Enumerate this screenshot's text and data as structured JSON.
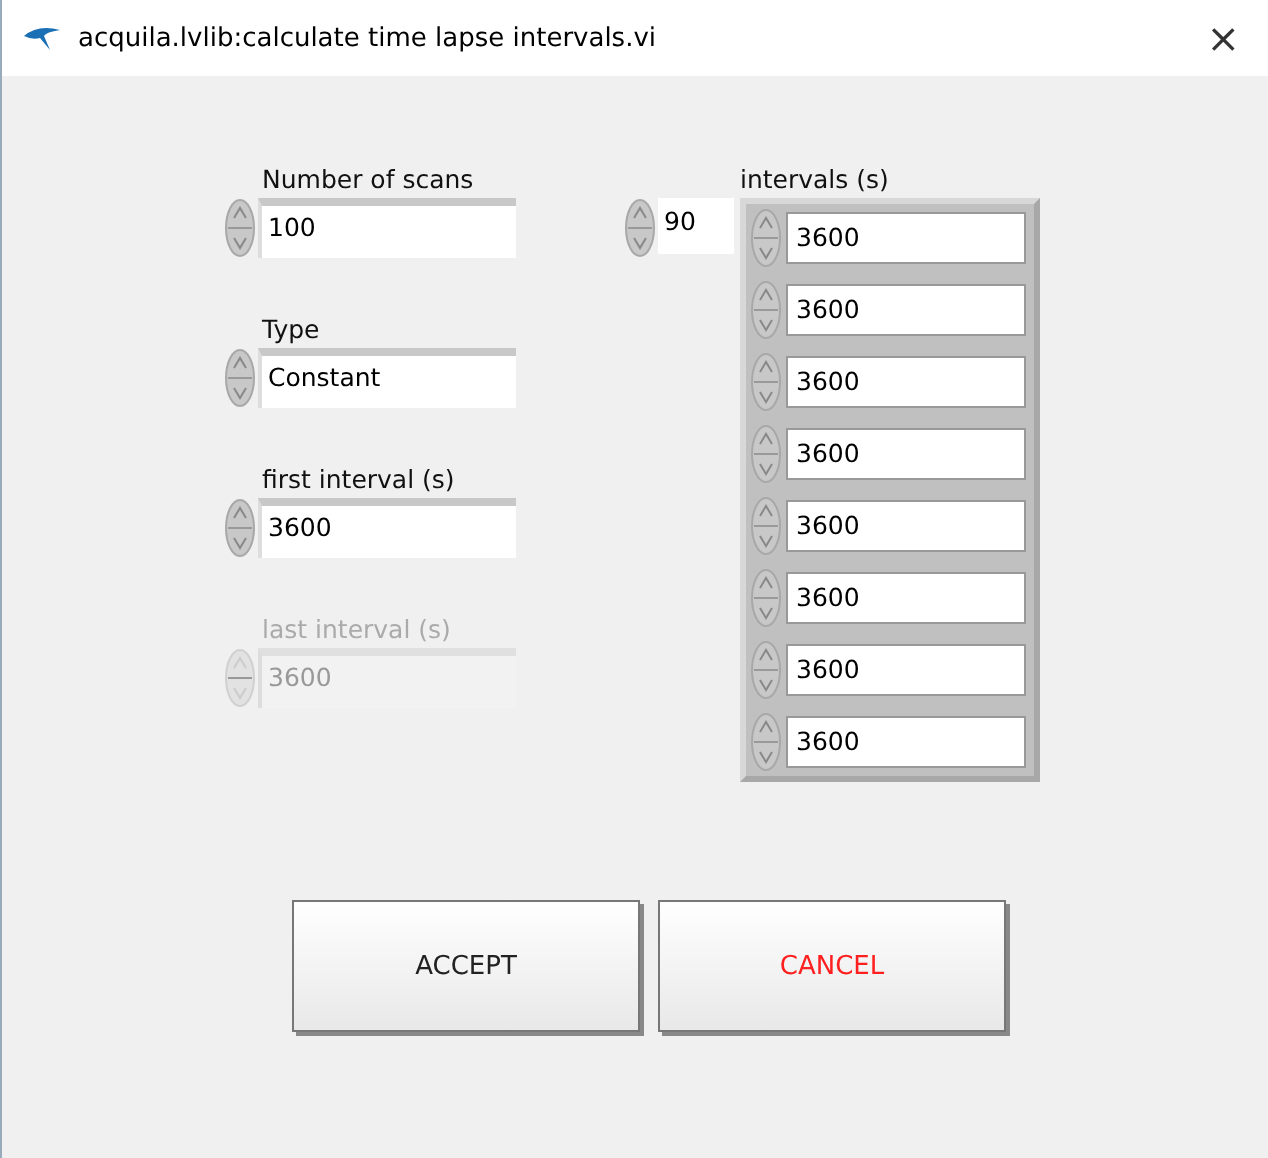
{
  "window": {
    "title": "acquila.lvlib:calculate time lapse intervals.vi",
    "close": "×"
  },
  "controls": [
    {
      "label": "Number of scans",
      "value": "100",
      "disabled": false
    },
    {
      "label": "Type",
      "value": "Constant",
      "disabled": false
    },
    {
      "label": "first interval (s)",
      "value": "3600",
      "disabled": false
    },
    {
      "label": "last interval (s)",
      "value": "3600",
      "disabled": true
    }
  ],
  "intervals": {
    "label": "intervals (s)",
    "index": "90",
    "values": [
      "3600",
      "3600",
      "3600",
      "3600",
      "3600",
      "3600",
      "3600",
      "3600"
    ]
  },
  "buttons": [
    {
      "label": "ACCEPT",
      "color": "#222222"
    },
    {
      "label": "CANCEL",
      "color": "#ff2020"
    }
  ]
}
